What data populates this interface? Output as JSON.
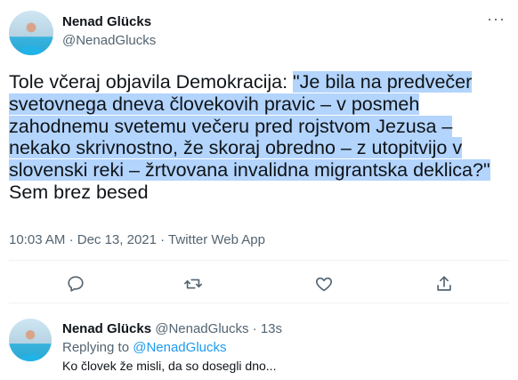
{
  "tweet": {
    "author_name": "Nenad Glücks",
    "author_handle": "@NenadGlucks",
    "more_label": "···",
    "text_prefix": "Tole včeraj objavila Demokracija: ",
    "text_highlighted": "\"Je bila na predvečer svetovnega dneva človekovih pravic – v posmeh zahodnemu svetemu večeru pred rojstvom Jezusa – nekako skrivnostno, že skoraj obredno – z utopitvijo v slovenski reki – žrtvovana invalidna migrantska deklica?\"",
    "text_suffix": " Sem brez besed",
    "time": "10:03 AM",
    "date": "Dec 13, 2021",
    "source": "Twitter Web App",
    "meta_sep": "·",
    "actions": {
      "reply_icon": "reply-icon",
      "retweet_icon": "retweet-icon",
      "like_icon": "heart-icon",
      "share_icon": "share-icon"
    }
  },
  "reply": {
    "author_name": "Nenad Glücks",
    "author_handle": "@NenadGlucks",
    "sep": "·",
    "age": "13s",
    "replying_prefix": "Replying to ",
    "replying_handle": "@NenadGlucks",
    "text": "Ko človek že misli, da so dosegli dno..."
  },
  "colors": {
    "highlight": "#b3d4fc",
    "link": "#1d9bf0",
    "secondary_text": "#536471",
    "primary_text": "#0f1419"
  }
}
